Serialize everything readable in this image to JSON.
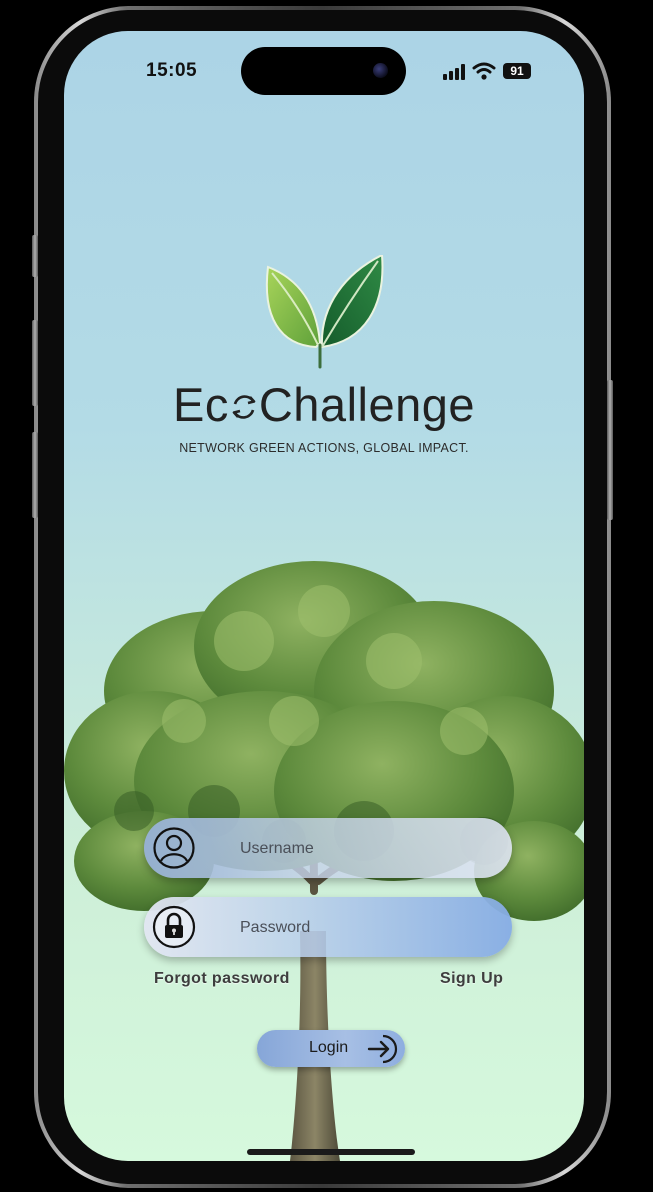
{
  "status_bar": {
    "time": "15:05",
    "battery": "91",
    "icons": [
      "signal-icon",
      "wifi-icon",
      "battery-icon"
    ]
  },
  "brand": {
    "name_prefix": "Ec",
    "name_suffix": "Challenge",
    "tagline": "NETWORK GREEN ACTIONS, GLOBAL IMPACT.",
    "logo_icon": "leaves-logo-icon",
    "colors": {
      "leaf_light": "#8cc63f",
      "leaf_dark": "#1e6b34"
    }
  },
  "form": {
    "username": {
      "placeholder": "Username",
      "value": "",
      "icon": "user-icon"
    },
    "password": {
      "placeholder": "Password",
      "value": "",
      "icon": "lock-icon"
    },
    "forgot_password": "Forgot password",
    "sign_up": "Sign Up",
    "login": "Login",
    "login_icon": "arrow-right-icon"
  },
  "colors": {
    "sky_top": "#acd4e6",
    "sky_bottom": "#d6f9dd",
    "button_blue": "#86a6d8"
  }
}
